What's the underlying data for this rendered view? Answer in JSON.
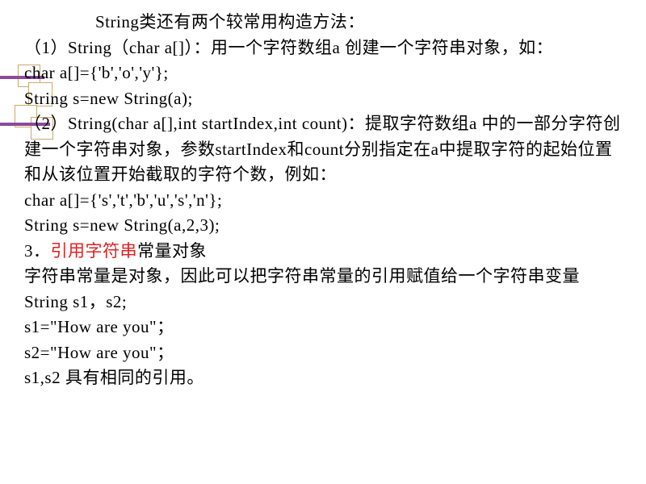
{
  "lines": {
    "l1": "String类还有两个较常用构造方法：",
    "l2": "（1）String（char a[]）：用一个字符数组a 创建一个字符串对象，如：",
    "l3": " char  a[]={'b','o','y'};",
    "l4": " String s=new String(a);",
    "l5": "（2）String(char a[],int startIndex,int count)：提取字符数组a 中的一部分字符创建一个字符串对象，参数startIndex和count分别指定在a中提取字符的起始位置和从该位置开始截取的字符个数，例如：",
    "l6": "  char a[]={'s','t','b','u','s','n'};",
    "l7": "  String s=new String(a,2,3);",
    "l8a": "  3．",
    "l8b": "引用字符串",
    "l8c": "常量对象",
    "l9": "  字符串常量是对象，因此可以把字符串常量的引用赋值给一个字符串变量",
    "l10": "        String s1，s2;",
    "l11": "        s1=\"How are you\"；",
    "l12": "        s2=\"How are you\"；",
    "l13": "    s1,s2 具有相同的引用。"
  }
}
